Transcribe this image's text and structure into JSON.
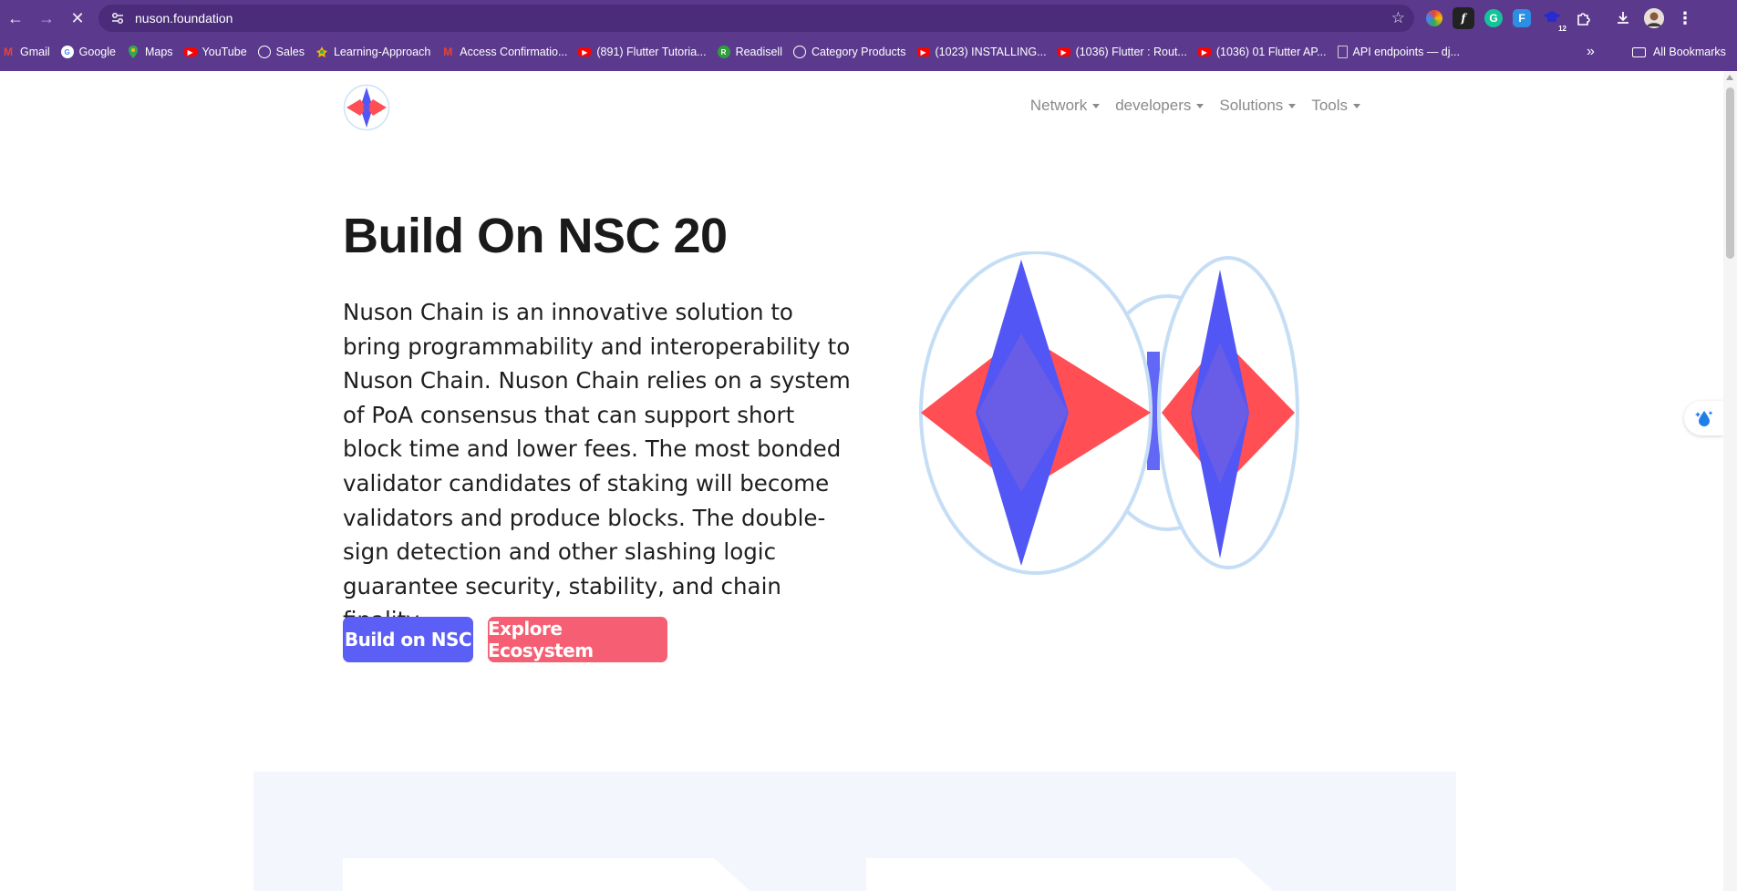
{
  "browser": {
    "url": "nuson.foundation",
    "bookmarks": [
      {
        "label": "Gmail",
        "icon": "gmail-icon",
        "color": "#ea4335"
      },
      {
        "label": "Google",
        "icon": "google-icon",
        "color": "#4285f4"
      },
      {
        "label": "Maps",
        "icon": "maps-icon",
        "color": "#34a853"
      },
      {
        "label": "YouTube",
        "icon": "youtube-icon",
        "color": "#ff0000"
      },
      {
        "label": "Sales",
        "icon": "globe-icon",
        "color": "#ffffff"
      },
      {
        "label": "Learning-Approach",
        "icon": "sheets-icon",
        "color": "#34a853"
      },
      {
        "label": "Access Confirmatio...",
        "icon": "gmail-icon",
        "color": "#ea4335"
      },
      {
        "label": "(891) Flutter Tutoria...",
        "icon": "youtube-icon",
        "color": "#ff0000"
      },
      {
        "label": "Readisell",
        "icon": "readisell-icon",
        "color": "#2e9e3c"
      },
      {
        "label": "Category Products",
        "icon": "globe-icon",
        "color": "#ffffff"
      },
      {
        "label": "(1023) INSTALLING...",
        "icon": "youtube-icon",
        "color": "#ff0000"
      },
      {
        "label": "(1036) Flutter : Rout...",
        "icon": "youtube-icon",
        "color": "#ff0000"
      },
      {
        "label": "(1036) 01 Flutter AP...",
        "icon": "youtube-icon",
        "color": "#ff0000"
      },
      {
        "label": "API endpoints — dj...",
        "icon": "doc-icon",
        "color": "#cfcfcf"
      }
    ],
    "all_bookmarks": "All Bookmarks",
    "ext_badge": "12"
  },
  "nav": {
    "items": [
      "Network",
      "developers",
      "Solutions",
      "Tools"
    ]
  },
  "hero": {
    "title": "Build On NSC 20",
    "body": "Nuson Chain is an innovative solution to bring programmability and interoperability to Nuson Chain. Nuson Chain relies on a system of PoA consensus that can support short block time and lower fees. The most bonded validator candidates of staking will become validators and produce blocks. The double-sign detection and other slashing logic guarantee security, stability, and chain finality.",
    "primary_button": "Build on NSC",
    "secondary_button": "Explore Ecosystem"
  },
  "colors": {
    "chrome": "#5b3a8e",
    "primary": "#5b5ff5",
    "secondary": "#f55e73",
    "diamond_red": "#ff4f55",
    "diamond_blue": "#5256f5",
    "ring": "#c5def5",
    "section_bg": "#f3f7fd"
  }
}
